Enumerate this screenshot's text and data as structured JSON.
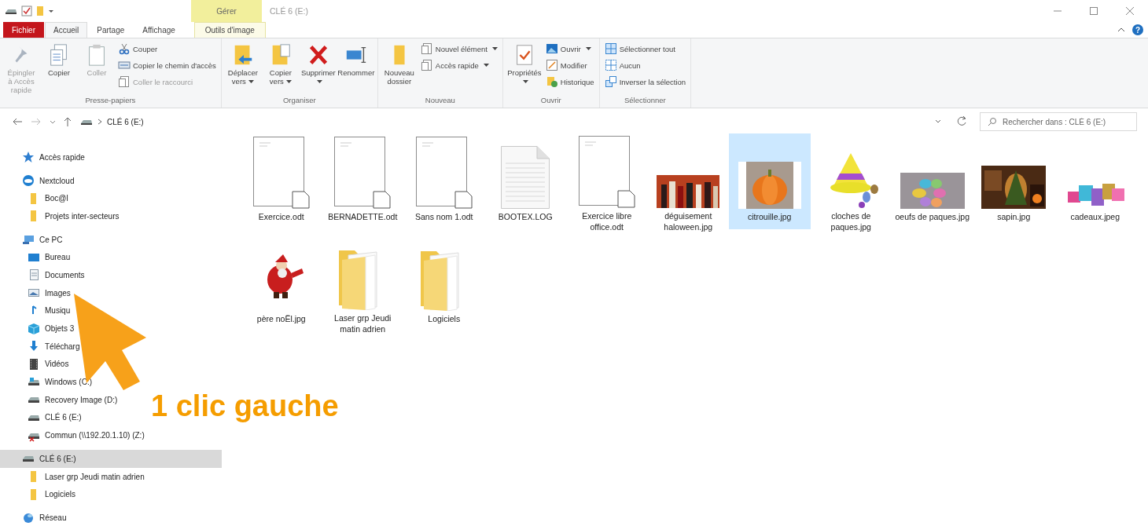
{
  "title_bar": {
    "context_tab": "Gérer",
    "title": "CLÉ 6 (E:)"
  },
  "ribbon_tabs": [
    {
      "label": "Fichier",
      "kind": "file",
      "selected": false
    },
    {
      "label": "Accueil",
      "kind": "normal",
      "selected": true
    },
    {
      "label": "Partage",
      "kind": "normal",
      "selected": false
    },
    {
      "label": "Affichage",
      "kind": "normal",
      "selected": false
    },
    {
      "label": "Outils d'image",
      "kind": "context",
      "selected": false
    }
  ],
  "help_button": "?",
  "ribbon_groups": [
    {
      "label": "Presse-papiers",
      "commands": [
        {
          "label": "Épingler à Accès rapide",
          "kind": "large",
          "disabled": true,
          "dropdown": false
        },
        {
          "label": "Copier",
          "kind": "large",
          "disabled": false,
          "dropdown": false
        },
        {
          "label": "Coller",
          "kind": "large",
          "disabled": true,
          "dropdown": false
        },
        {
          "label": "Couper",
          "kind": "small",
          "disabled": false,
          "dropdown": false
        },
        {
          "label": "Copier le chemin d'accès",
          "kind": "small",
          "disabled": false,
          "dropdown": false
        },
        {
          "label": "Coller le raccourci",
          "kind": "small",
          "disabled": true,
          "dropdown": false
        }
      ]
    },
    {
      "label": "Organiser",
      "commands": [
        {
          "label": "Déplacer vers",
          "kind": "large",
          "disabled": false,
          "dropdown": true
        },
        {
          "label": "Copier vers",
          "kind": "large",
          "disabled": false,
          "dropdown": true
        },
        {
          "label": "Supprimer",
          "kind": "large",
          "disabled": false,
          "dropdown": true
        },
        {
          "label": "Renommer",
          "kind": "large",
          "disabled": false,
          "dropdown": false
        }
      ]
    },
    {
      "label": "Nouveau",
      "commands": [
        {
          "label": "Nouveau dossier",
          "kind": "large",
          "disabled": false,
          "dropdown": false
        },
        {
          "label": "Nouvel élément",
          "kind": "small",
          "disabled": false,
          "dropdown": true
        },
        {
          "label": "Accès rapide",
          "kind": "small",
          "disabled": false,
          "dropdown": true
        }
      ]
    },
    {
      "label": "Ouvrir",
      "commands": [
        {
          "label": "Propriétés",
          "kind": "large",
          "disabled": false,
          "dropdown": true
        },
        {
          "label": "Ouvrir",
          "kind": "small",
          "disabled": false,
          "dropdown": true
        },
        {
          "label": "Modifier",
          "kind": "small",
          "disabled": false,
          "dropdown": false
        },
        {
          "label": "Historique",
          "kind": "small",
          "disabled": false,
          "dropdown": false
        }
      ]
    },
    {
      "label": "Sélectionner",
      "commands": [
        {
          "label": "Sélectionner tout",
          "kind": "small",
          "disabled": false,
          "dropdown": false
        },
        {
          "label": "Aucun",
          "kind": "small",
          "disabled": false,
          "dropdown": false
        },
        {
          "label": "Inverser la sélection",
          "kind": "small",
          "disabled": false,
          "dropdown": false
        }
      ]
    }
  ],
  "address_bar": {
    "path": [
      "CLÉ 6 (E:)"
    ]
  },
  "search": {
    "placeholder": "Rechercher dans : CLÉ 6 (E:)"
  },
  "sidebar": {
    "items": [
      {
        "label": "Accès rapide",
        "kind": "star",
        "selected": false
      },
      {
        "label": "Nextcloud",
        "kind": "cloud",
        "selected": false,
        "children": [
          {
            "label": "Boc@l",
            "kind": "folder",
            "selected": false
          },
          {
            "label": "Projets inter-secteurs",
            "kind": "folder",
            "selected": false
          }
        ]
      },
      {
        "label": "Ce PC",
        "kind": "pc",
        "selected": false,
        "children": [
          {
            "label": "Bureau",
            "kind": "desktop",
            "selected": false
          },
          {
            "label": "Documents",
            "kind": "docs",
            "selected": false
          },
          {
            "label": "Images",
            "kind": "images",
            "selected": false
          },
          {
            "label": "Musiqu",
            "kind": "music",
            "selected": false
          },
          {
            "label": "Objets 3",
            "kind": "objects",
            "selected": false
          },
          {
            "label": "Télécharg",
            "kind": "download",
            "selected": false
          },
          {
            "label": "Vidéos",
            "kind": "videos",
            "selected": false
          },
          {
            "label": "Windows (C:)",
            "kind": "windows",
            "selected": false
          },
          {
            "label": "Recovery Image (D:)",
            "kind": "drive",
            "selected": false
          },
          {
            "label": "CLÉ 6 (E:)",
            "kind": "drive",
            "selected": false
          },
          {
            "label": "Commun (\\\\192.20.1.10) (Z:)",
            "kind": "netdrive",
            "selected": false
          }
        ]
      },
      {
        "label": "CLÉ 6 (E:)",
        "kind": "drive",
        "selected": true,
        "children": [
          {
            "label": "Laser grp Jeudi matin adrien",
            "kind": "folder",
            "selected": false
          },
          {
            "label": "Logiciels",
            "kind": "folder",
            "selected": false
          }
        ]
      },
      {
        "label": "Réseau",
        "kind": "network",
        "selected": false
      }
    ]
  },
  "files": [
    {
      "name": "Exercice.odt",
      "kind": "document",
      "selected": false
    },
    {
      "name": "BERNADETTE.odt",
      "kind": "document",
      "selected": false
    },
    {
      "name": "Sans nom 1.odt",
      "kind": "document",
      "selected": false
    },
    {
      "name": "BOOTEX.LOG",
      "kind": "log",
      "selected": false
    },
    {
      "name": "Exercice libre office.odt",
      "kind": "document",
      "selected": false
    },
    {
      "name": "déguisement haloween.jpg",
      "kind": "picture",
      "selected": false
    },
    {
      "name": "citrouille.jpg",
      "kind": "picture",
      "selected": true
    },
    {
      "name": "cloches de paques.jpg",
      "kind": "picture",
      "selected": false
    },
    {
      "name": "oeufs de paques.jpg",
      "kind": "picture",
      "selected": false
    },
    {
      "name": "sapin.jpg",
      "kind": "picture",
      "selected": false
    },
    {
      "name": "cadeaux.jpeg",
      "kind": "picture",
      "selected": false
    },
    {
      "name": "père noËl.jpg",
      "kind": "picture",
      "selected": false
    },
    {
      "name": "Laser grp Jeudi matin adrien",
      "kind": "folder",
      "selected": false
    },
    {
      "name": "Logiciels",
      "kind": "folder",
      "selected": false
    }
  ],
  "annotation": {
    "text": "1 clic gauche"
  }
}
